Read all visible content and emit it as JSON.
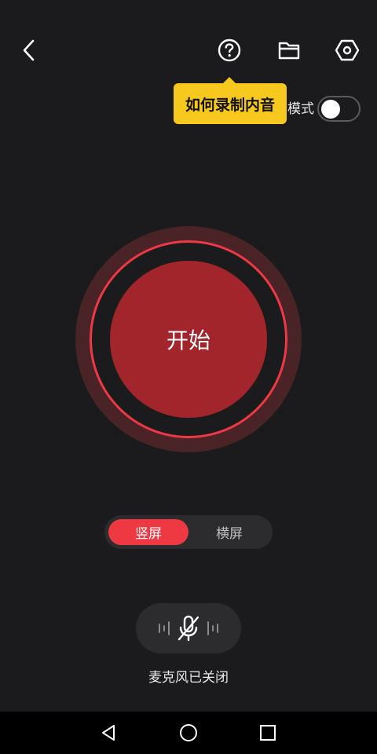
{
  "header": {
    "back_icon": "chevron-left-icon",
    "help_icon": "question-circle-icon",
    "folder_icon": "folder-icon",
    "settings_icon": "hexagon-gear-icon"
  },
  "tooltip": {
    "text": "如何录制内音",
    "background": "#f7c81d"
  },
  "mode": {
    "label_visible": "模式",
    "toggle_on": false
  },
  "record": {
    "label": "开始",
    "ring_color": "#ec3945",
    "core_color": "#a1252b"
  },
  "orientation": {
    "options": [
      "竖屏",
      "横屏"
    ],
    "selected": "竖屏",
    "accent": "#ee3842"
  },
  "mic": {
    "icon": "mic-off-icon",
    "status": "麦克风已关闭"
  },
  "navbar": {
    "icons": [
      "back-triangle-icon",
      "home-circle-icon",
      "recent-square-icon"
    ]
  }
}
